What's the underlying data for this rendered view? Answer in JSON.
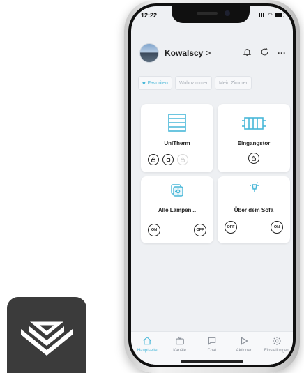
{
  "status_bar": {
    "time": "12:22"
  },
  "header": {
    "home_name": "Kowalscy",
    "chevron": ">"
  },
  "tabs": [
    {
      "label": "Favoriten",
      "active": true
    },
    {
      "label": "Wohnzimmer",
      "active": false
    },
    {
      "label": "Mein Zimmer",
      "active": false
    }
  ],
  "devices": [
    {
      "name": "UniTherm"
    },
    {
      "name": "Eingangstor"
    },
    {
      "name": "Alle Lampen...",
      "left_btn": "ON",
      "right_btn": "OFF"
    },
    {
      "name": "Über dem Sofa",
      "left_btn": "OFF",
      "right_btn": "ON"
    }
  ],
  "nav": [
    {
      "label": "Hauptseite",
      "icon": "home-icon",
      "active": true
    },
    {
      "label": "Kanäle",
      "icon": "tv-icon",
      "active": false
    },
    {
      "label": "Chat",
      "icon": "chat-icon",
      "active": false
    },
    {
      "label": "Aktionen",
      "icon": "play-icon",
      "active": false
    },
    {
      "label": "Einstellungen",
      "icon": "gear-icon",
      "active": false
    }
  ],
  "colors": {
    "accent": "#48b7d8",
    "background": "#eef0f3",
    "logo_bg": "#3b3b3b"
  }
}
